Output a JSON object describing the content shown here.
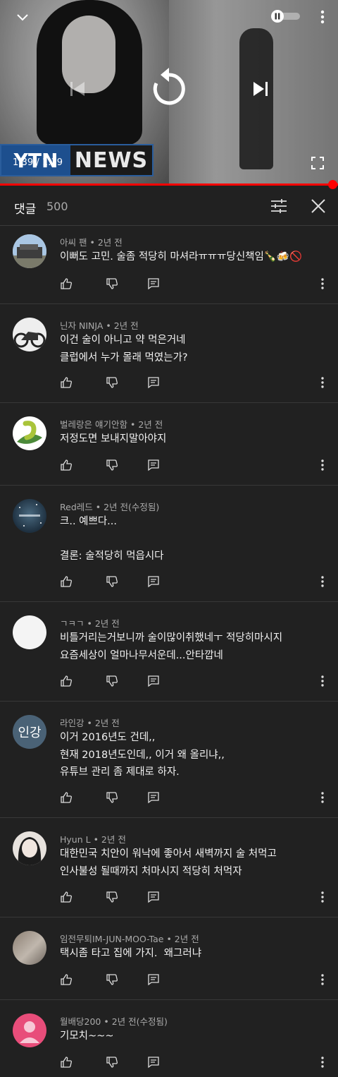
{
  "player": {
    "time": "1:39 / 1:39",
    "logo_left": "YTN",
    "logo_right": "NEWS",
    "progress_fraction": 1.0,
    "accent_color": "#ff0000"
  },
  "comments_header": {
    "title": "댓글",
    "count": "500"
  },
  "comments": [
    {
      "author": "아씨 팬",
      "time": "2년 전",
      "edited": "",
      "lines": [
        "이뻐도 고민. 술좀 적당히 마셔라ㅠㅠㅠ당신책임🍾🍻🚫"
      ]
    },
    {
      "author": "닌자 NINJA",
      "time": "2년 전",
      "edited": "",
      "lines": [
        "이건 술이 아니고 약 먹은거네",
        "클럽에서 누가 몰래 먹였는가?"
      ]
    },
    {
      "author": "벌레랑은 얘기안함",
      "time": "2년 전",
      "edited": "",
      "lines": [
        "저정도면 보내지말아야지"
      ]
    },
    {
      "author": "Red레드",
      "time": "2년 전",
      "edited": "(수정됨)",
      "lines": [
        "크.. 예쁘다...",
        "",
        "결론: 술적당히 먹읍시다"
      ]
    },
    {
      "author": "ㄱㅋㄱ",
      "time": "2년 전",
      "edited": "",
      "lines": [
        "비틀거리는거보니까 술이많이취했네ㅜ 적당히마시지",
        "요즘세상이 얼마나무서운데...안타깝네"
      ]
    },
    {
      "author": "라인강",
      "time": "2년 전",
      "edited": "",
      "avatar_text": "인강",
      "lines": [
        "이거 2016년도 건데,,",
        "현재 2018년도인데,, 이거 왜 올리냐,,",
        "유튜브 관리 좀 제대로 하자."
      ]
    },
    {
      "author": "Hyun L",
      "time": "2년 전",
      "edited": "",
      "lines": [
        "대한민국 치안이 워낙에 좋아서 새벽까지 술 처먹고",
        "인사불성 될때까지 처마시지 적당히 처먹자"
      ]
    },
    {
      "author": "임전무퇴IM-JUN-MOO-Tae",
      "time": "2년 전",
      "edited": "",
      "lines": [
        "택시좀 타고 집에 가지.  왜그러냐"
      ]
    },
    {
      "author": "월배당200",
      "time": "2년 전",
      "edited": "(수정됨)",
      "lines": [
        "기모치~~~"
      ]
    }
  ]
}
